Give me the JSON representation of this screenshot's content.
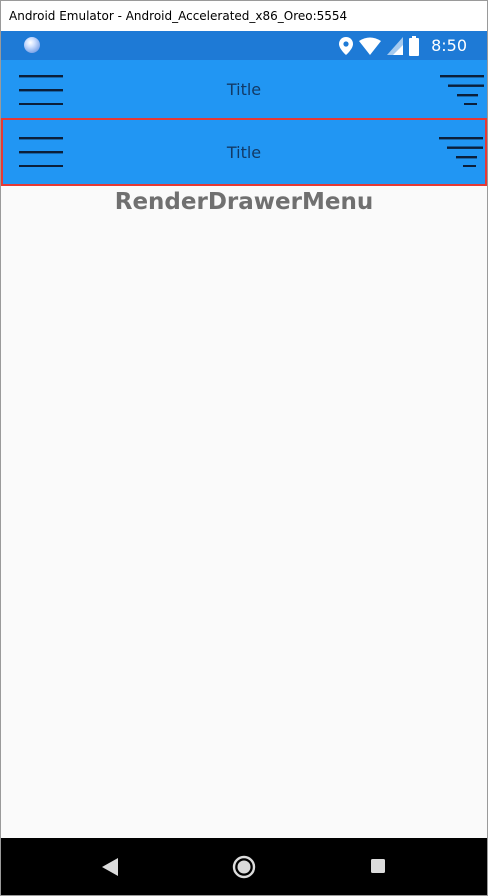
{
  "window": {
    "title": "Android Emulator - Android_Accelerated_x86_Oreo:5554"
  },
  "statusbar": {
    "time": "8:50",
    "icons": [
      "notification-dot-icon",
      "location-icon",
      "wifi-icon",
      "signal-icon",
      "battery-icon"
    ]
  },
  "appbars": [
    {
      "title": "Title",
      "left_icon": "hamburger-menu-icon",
      "right_icon": "filter-icon"
    },
    {
      "title": "Title",
      "left_icon": "hamburger-menu-icon",
      "right_icon": "filter-icon"
    }
  ],
  "content": {
    "heading": "RenderDrawerMenu"
  },
  "navbar": {
    "icons": [
      "back-icon",
      "home-icon",
      "recents-icon"
    ]
  },
  "colors": {
    "statusbar": "#1e7ad6",
    "appbar": "#2196f3",
    "highlight_border": "#e53935",
    "navbar": "#000000",
    "background": "#fafafa"
  }
}
